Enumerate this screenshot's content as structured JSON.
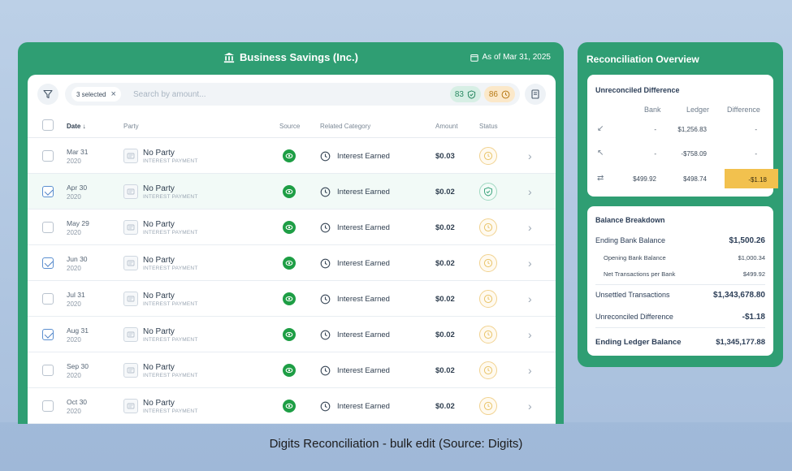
{
  "main": {
    "title": "Business Savings (Inc.)",
    "as_of": "As of Mar 31, 2025",
    "toolbar": {
      "selected_label": "3 selected",
      "search_placeholder": "Search by amount...",
      "count_reconciled": "83",
      "count_pending": "86"
    },
    "columns": {
      "date": "Date ↓",
      "party": "Party",
      "source": "Source",
      "category": "Related Category",
      "amount": "Amount",
      "status": "Status"
    },
    "rows": [
      {
        "date": "Mar 31",
        "year": "2020",
        "party": "No Party",
        "party_sub": "INTEREST PAYMENT",
        "category": "Interest Earned",
        "amount": "$0.03",
        "status": "pending",
        "checked": false
      },
      {
        "date": "Apr 30",
        "year": "2020",
        "party": "No Party",
        "party_sub": "INTEREST PAYMENT",
        "category": "Interest Earned",
        "amount": "$0.02",
        "status": "reconciled",
        "checked": true
      },
      {
        "date": "May 29",
        "year": "2020",
        "party": "No Party",
        "party_sub": "INTEREST PAYMENT",
        "category": "Interest Earned",
        "amount": "$0.02",
        "status": "pending",
        "checked": false
      },
      {
        "date": "Jun 30",
        "year": "2020",
        "party": "No Party",
        "party_sub": "INTEREST PAYMENT",
        "category": "Interest Earned",
        "amount": "$0.02",
        "status": "pending",
        "checked": true
      },
      {
        "date": "Jul 31",
        "year": "2020",
        "party": "No Party",
        "party_sub": "INTEREST PAYMENT",
        "category": "Interest Earned",
        "amount": "$0.02",
        "status": "pending",
        "checked": false
      },
      {
        "date": "Aug 31",
        "year": "2020",
        "party": "No Party",
        "party_sub": "INTEREST PAYMENT",
        "category": "Interest Earned",
        "amount": "$0.02",
        "status": "pending",
        "checked": true
      },
      {
        "date": "Sep 30",
        "year": "2020",
        "party": "No Party",
        "party_sub": "INTEREST PAYMENT",
        "category": "Interest Earned",
        "amount": "$0.02",
        "status": "pending",
        "checked": false
      },
      {
        "date": "Oct 30",
        "year": "2020",
        "party": "No Party",
        "party_sub": "INTEREST PAYMENT",
        "category": "Interest Earned",
        "amount": "$0.02",
        "status": "pending",
        "checked": false
      }
    ]
  },
  "side": {
    "title": "Reconciliation Overview",
    "unreconciled": {
      "title": "Unreconciled Difference",
      "headers": {
        "bank": "Bank",
        "ledger": "Ledger",
        "difference": "Difference"
      },
      "rows": [
        {
          "icon": "arrow-down-left-icon",
          "bank": "-",
          "ledger": "$1,256.83",
          "difference": "-"
        },
        {
          "icon": "arrow-up-left-icon",
          "bank": "-",
          "ledger": "-$758.09",
          "difference": "-"
        },
        {
          "icon": "swap-icon",
          "bank": "$499.92",
          "ledger": "$498.74",
          "difference": "-$1.18"
        }
      ]
    },
    "breakdown": {
      "title": "Balance Breakdown",
      "ending_bank_label": "Ending Bank Balance",
      "ending_bank_value": "$1,500.26",
      "opening_bank_label": "Opening Bank Balance",
      "opening_bank_value": "$1,000.34",
      "net_tx_label": "Net Transactions per Bank",
      "net_tx_value": "$499.92",
      "unsettled_label": "Unsettled Transactions",
      "unsettled_value": "$1,343,678.80",
      "unreconciled_label": "Unreconciled Difference",
      "unreconciled_value": "-$1.18",
      "ending_ledger_label": "Ending Ledger Balance",
      "ending_ledger_value": "$1,345,177.88"
    }
  },
  "caption": "Digits Reconciliation - bulk edit (Source: Digits)",
  "colors": {
    "brand_green": "#2f9e73",
    "highlight_yellow": "#f2c14e",
    "pending_amber": "#f1d28f"
  }
}
